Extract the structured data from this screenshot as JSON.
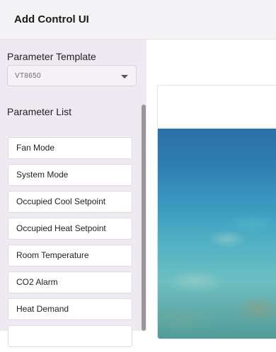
{
  "header": {
    "title": "Add Control UI"
  },
  "sidebar": {
    "template_label": "Parameter Template",
    "template_value": "VT8650",
    "list_label": "Parameter List",
    "items": [
      {
        "label": "Fan Mode"
      },
      {
        "label": "System Mode"
      },
      {
        "label": "Occupied Cool Setpoint"
      },
      {
        "label": "Occupied Heat Setpoint"
      },
      {
        "label": "Room Temperature"
      },
      {
        "label": "CO2 Alarm"
      },
      {
        "label": "Heat Demand"
      },
      {
        "label": ""
      }
    ]
  },
  "icons": {
    "dropdown": "chevron-down-icon"
  },
  "colors": {
    "header_bg": "#f4f4f6",
    "sidebar_bg": "#efeaf1",
    "scrollbar": "#9a969c"
  }
}
